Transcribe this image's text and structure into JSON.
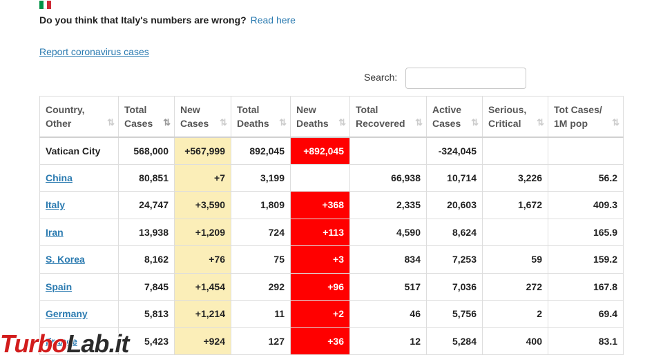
{
  "flag": {
    "name": "italy-flag",
    "colors": [
      "#009246",
      "#ffffff",
      "#ce2b37"
    ]
  },
  "question": {
    "text": "Do you think that Italy's numbers are wrong?",
    "link": "Read here"
  },
  "report_link": "Report coronavirus cases",
  "search": {
    "label": "Search:",
    "value": ""
  },
  "table": {
    "headers": [
      {
        "label1": "Country,",
        "label2": "Other",
        "sort": "⇅",
        "sort_active": false
      },
      {
        "label1": "Total",
        "label2": "Cases",
        "sort": "⇅",
        "sort_active": true
      },
      {
        "label1": "New",
        "label2": "Cases",
        "sort": "⇅",
        "sort_active": false
      },
      {
        "label1": "Total",
        "label2": "Deaths",
        "sort": "⇅",
        "sort_active": false
      },
      {
        "label1": "New",
        "label2": "Deaths",
        "sort": "⇅",
        "sort_active": false
      },
      {
        "label1": "Total",
        "label2": "Recovered",
        "sort": "⇅",
        "sort_active": false
      },
      {
        "label1": "Active",
        "label2": "Cases",
        "sort": "⇅",
        "sort_active": false
      },
      {
        "label1": "Serious,",
        "label2": "Critical",
        "sort": "⇅",
        "sort_active": false
      },
      {
        "label1": "Tot Cases/",
        "label2": "1M pop",
        "sort": "⇅",
        "sort_active": false
      }
    ],
    "rows": [
      {
        "country": "Vatican City",
        "link": false,
        "total_cases": "568,000",
        "new_cases": "+567,999",
        "total_deaths": "892,045",
        "new_deaths": "+892,045",
        "total_recovered": "",
        "active_cases": "-324,045",
        "serious": "",
        "per_million": ""
      },
      {
        "country": "China",
        "link": true,
        "total_cases": "80,851",
        "new_cases": "+7",
        "total_deaths": "3,199",
        "new_deaths": "",
        "total_recovered": "66,938",
        "active_cases": "10,714",
        "serious": "3,226",
        "per_million": "56.2"
      },
      {
        "country": "Italy",
        "link": true,
        "total_cases": "24,747",
        "new_cases": "+3,590",
        "total_deaths": "1,809",
        "new_deaths": "+368",
        "total_recovered": "2,335",
        "active_cases": "20,603",
        "serious": "1,672",
        "per_million": "409.3"
      },
      {
        "country": "Iran",
        "link": true,
        "total_cases": "13,938",
        "new_cases": "+1,209",
        "total_deaths": "724",
        "new_deaths": "+113",
        "total_recovered": "4,590",
        "active_cases": "8,624",
        "serious": "",
        "per_million": "165.9"
      },
      {
        "country": "S. Korea",
        "link": true,
        "total_cases": "8,162",
        "new_cases": "+76",
        "total_deaths": "75",
        "new_deaths": "+3",
        "total_recovered": "834",
        "active_cases": "7,253",
        "serious": "59",
        "per_million": "159.2"
      },
      {
        "country": "Spain",
        "link": true,
        "total_cases": "7,845",
        "new_cases": "+1,454",
        "total_deaths": "292",
        "new_deaths": "+96",
        "total_recovered": "517",
        "active_cases": "7,036",
        "serious": "272",
        "per_million": "167.8"
      },
      {
        "country": "Germany",
        "link": true,
        "total_cases": "5,813",
        "new_cases": "+1,214",
        "total_deaths": "11",
        "new_deaths": "+2",
        "total_recovered": "46",
        "active_cases": "5,756",
        "serious": "2",
        "per_million": "69.4"
      },
      {
        "country": "France",
        "link": true,
        "total_cases": "5,423",
        "new_cases": "+924",
        "total_deaths": "127",
        "new_deaths": "+36",
        "total_recovered": "12",
        "active_cases": "5,284",
        "serious": "400",
        "per_million": "83.1"
      }
    ]
  },
  "watermark": {
    "part1": "Turbo",
    "part2": "Lab.it"
  }
}
